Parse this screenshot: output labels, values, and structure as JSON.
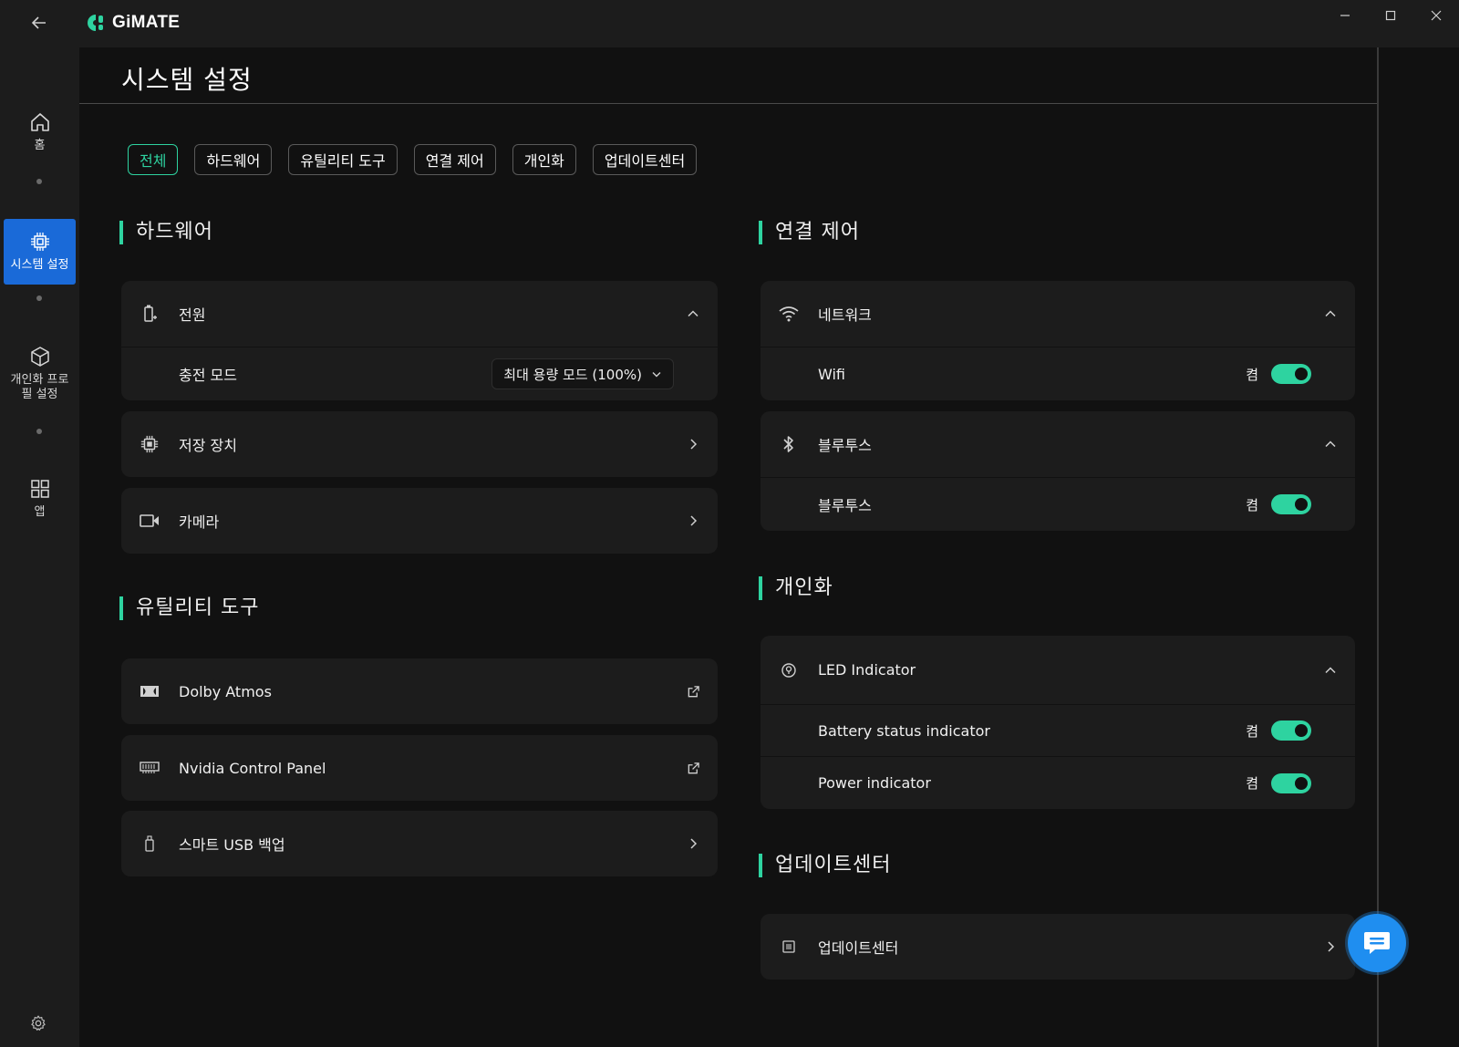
{
  "app": {
    "name": "GiMATE"
  },
  "sidebar": {
    "items": [
      {
        "label": "홈",
        "icon": "home-icon"
      },
      {
        "label": "시스템 설정",
        "icon": "chip-icon",
        "active": true
      },
      {
        "label": "개인화 프로\n필 설정",
        "icon": "cube-icon"
      },
      {
        "label": "앱",
        "icon": "grid-icon"
      }
    ]
  },
  "page": {
    "title": "시스템 설정"
  },
  "tabs": [
    {
      "label": "전체",
      "active": true
    },
    {
      "label": "하드웨어"
    },
    {
      "label": "유틸리티 도구"
    },
    {
      "label": "연결 제어"
    },
    {
      "label": "개인화"
    },
    {
      "label": "업데이트센터"
    }
  ],
  "sections": {
    "hardware": {
      "title": "하드웨어",
      "power": {
        "label": "전원",
        "charge_mode_label": "충전 모드",
        "charge_mode_value": "최대 용량 모드 (100%)"
      },
      "storage": {
        "label": "저장 장치"
      },
      "camera": {
        "label": "카메라"
      }
    },
    "utility": {
      "title": "유틸리티 도구",
      "dolby": {
        "label": "Dolby Atmos"
      },
      "nvidia": {
        "label": "Nvidia Control Panel"
      },
      "usb_backup": {
        "label": "스마트 USB 백업"
      }
    },
    "connection": {
      "title": "연결 제어",
      "network": {
        "label": "네트워크",
        "wifi_label": "Wifi",
        "wifi_state": "켬"
      },
      "bluetooth": {
        "label": "블루투스",
        "bt_label": "블루투스",
        "bt_state": "켬"
      }
    },
    "personalize": {
      "title": "개인화",
      "led": {
        "label": "LED Indicator",
        "battery_label": "Battery status indicator",
        "battery_state": "켬",
        "power_label": "Power indicator",
        "power_state": "켬"
      }
    },
    "update": {
      "title": "업데이트센터",
      "center": {
        "label": "업데이트센터"
      }
    }
  },
  "colors": {
    "accent": "#2ed3a0",
    "active_nav": "#1a6ad8",
    "card": "#1c1c1c",
    "background": "#111111",
    "fab": "#1f8ef0"
  }
}
